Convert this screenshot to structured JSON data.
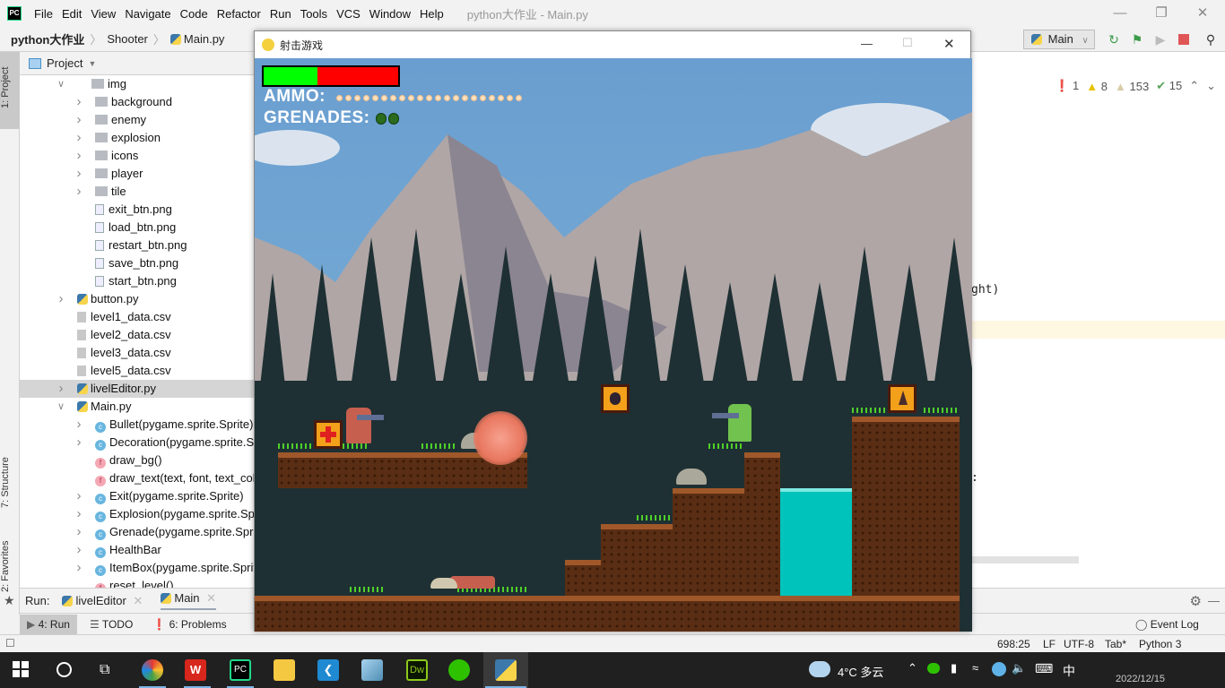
{
  "ide": {
    "menu": [
      "File",
      "Edit",
      "View",
      "Navigate",
      "Code",
      "Refactor",
      "Run",
      "Tools",
      "VCS",
      "Window",
      "Help"
    ],
    "window_title": "python大作业 - Main.py",
    "breadcrumb": [
      "python大作业",
      "Shooter",
      "Main.py"
    ],
    "run_config": "Main",
    "inspections": {
      "errors": "1",
      "warnings": "8",
      "weak_warnings": "153",
      "typos": "15"
    },
    "editor_fragments": [
      "ght)",
      ":"
    ],
    "left_stripe": {
      "project": "1: Project",
      "structure": "7: Structure",
      "favorites": "2: Favorites"
    },
    "project_panel": {
      "title": "Project",
      "tree": [
        {
          "label": "img",
          "kind": "folder",
          "level": 0,
          "state": "open"
        },
        {
          "label": "background",
          "kind": "folder",
          "level": 1,
          "state": "closed"
        },
        {
          "label": "enemy",
          "kind": "folder",
          "level": 1,
          "state": "closed"
        },
        {
          "label": "explosion",
          "kind": "folder",
          "level": 1,
          "state": "closed"
        },
        {
          "label": "icons",
          "kind": "folder",
          "level": 1,
          "state": "closed"
        },
        {
          "label": "player",
          "kind": "folder",
          "level": 1,
          "state": "closed"
        },
        {
          "label": "tile",
          "kind": "folder",
          "level": 1,
          "state": "closed"
        },
        {
          "label": "exit_btn.png",
          "kind": "image",
          "level": 1
        },
        {
          "label": "load_btn.png",
          "kind": "image",
          "level": 1
        },
        {
          "label": "restart_btn.png",
          "kind": "image",
          "level": 1
        },
        {
          "label": "save_btn.png",
          "kind": "image",
          "level": 1
        },
        {
          "label": "start_btn.png",
          "kind": "image",
          "level": 1
        },
        {
          "label": "button.py",
          "kind": "python",
          "level": 0,
          "state": "closed"
        },
        {
          "label": "level1_data.csv",
          "kind": "csv",
          "level": 0
        },
        {
          "label": "level2_data.csv",
          "kind": "csv",
          "level": 0
        },
        {
          "label": "level3_data.csv",
          "kind": "csv",
          "level": 0
        },
        {
          "label": "level5_data.csv",
          "kind": "csv",
          "level": 0
        },
        {
          "label": "livelEditor.py",
          "kind": "python",
          "level": 0,
          "state": "closed",
          "selected": true
        },
        {
          "label": "Main.py",
          "kind": "python",
          "level": 0,
          "state": "open"
        },
        {
          "label": "Bullet(pygame.sprite.Sprite)",
          "kind": "class",
          "level": 1,
          "state": "closed"
        },
        {
          "label": "Decoration(pygame.sprite.Sprite)",
          "kind": "class",
          "level": 1,
          "state": "closed"
        },
        {
          "label": "draw_bg()",
          "kind": "function",
          "level": 1
        },
        {
          "label": "draw_text(text, font, text_col, x, y)",
          "kind": "function",
          "level": 1
        },
        {
          "label": "Exit(pygame.sprite.Sprite)",
          "kind": "class",
          "level": 1,
          "state": "closed"
        },
        {
          "label": "Explosion(pygame.sprite.Sprite)",
          "kind": "class",
          "level": 1,
          "state": "closed"
        },
        {
          "label": "Grenade(pygame.sprite.Sprite)",
          "kind": "class",
          "level": 1,
          "state": "closed"
        },
        {
          "label": "HealthBar",
          "kind": "class",
          "level": 1,
          "state": "closed"
        },
        {
          "label": "ItemBox(pygame.sprite.Sprite)",
          "kind": "class",
          "level": 1,
          "state": "closed"
        },
        {
          "label": "reset_level()",
          "kind": "function",
          "level": 1
        }
      ]
    },
    "run_bar": {
      "label": "Run:",
      "tabs": [
        {
          "label": "livelEditor",
          "active": false
        },
        {
          "label": "Main",
          "active": true
        }
      ]
    },
    "bottom_tools": [
      {
        "label": "4: Run",
        "active": true
      },
      {
        "label": "TODO"
      },
      {
        "label": "6: Problems"
      }
    ],
    "event_log": "Event Log",
    "status": {
      "position": "698:25",
      "line_sep": "LF",
      "encoding": "UTF-8",
      "indent": "Tab*",
      "interpreter": "Python 3"
    }
  },
  "game": {
    "window_title": "射击游戏",
    "health_fraction": 0.4,
    "ammo_label": "AMMO:",
    "ammo_count": 21,
    "grenades_label": "GRENADES:",
    "grenade_count": 2,
    "colors": {
      "health_good": "#00ff00",
      "health_bad": "#ff0000",
      "water": "#00c4bb",
      "item_box": "#f3a01b"
    }
  },
  "taskbar": {
    "weather": "4°C 多云",
    "ime": "中",
    "date": "2022/12/15"
  }
}
